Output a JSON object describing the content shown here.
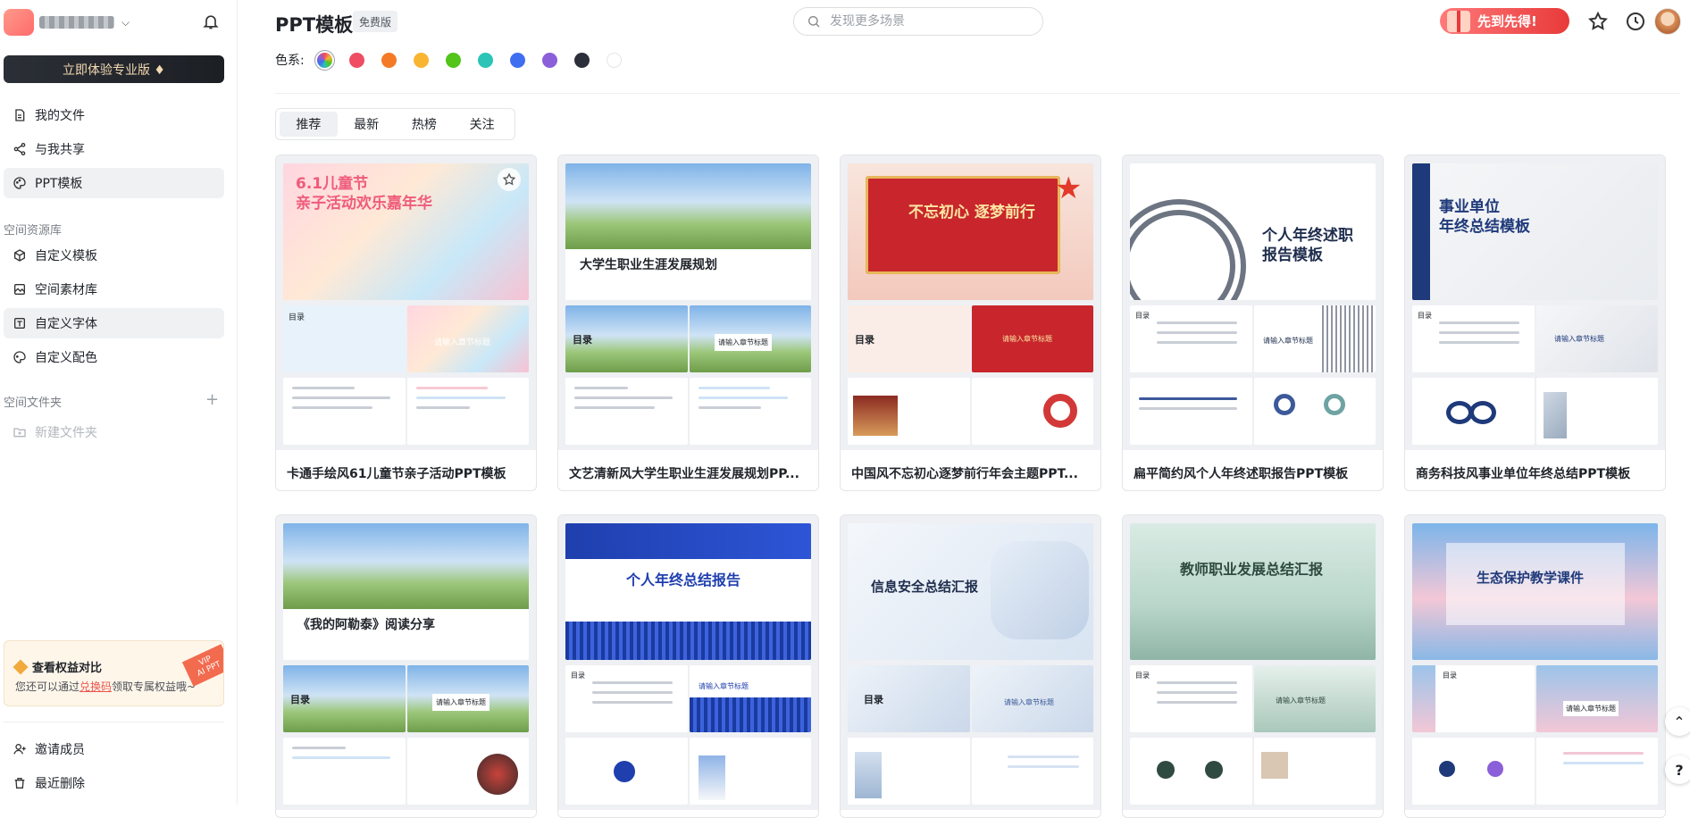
{
  "sidebar": {
    "pro_button": "立即体验专业版 ♦",
    "nav": [
      {
        "label": "我的文件"
      },
      {
        "label": "与我共享"
      },
      {
        "label": "PPT模板"
      }
    ],
    "space_library_label": "空间资源库",
    "space_items": [
      {
        "label": "自定义模板"
      },
      {
        "label": "空间素材库"
      },
      {
        "label": "自定义字体"
      },
      {
        "label": "自定义配色"
      }
    ],
    "folder_section_label": "空间文件夹",
    "new_folder": "新建文件夹",
    "vip": {
      "title": "查看权益对比",
      "sub_prefix": "您还可以通过",
      "sub_link": "兑换码",
      "sub_suffix": "领取专属权益哦~",
      "badge_top": "VIP",
      "badge_bottom": "AI PPT"
    },
    "bottom": [
      {
        "label": "邀请成员"
      },
      {
        "label": "最近删除"
      }
    ]
  },
  "header": {
    "title": "PPT模板",
    "badge": "免费版",
    "search_placeholder": "发现更多场景",
    "promo": "先到先得!"
  },
  "filters": {
    "color_label": "色系:",
    "swatches": [
      "rainbow",
      "#ee4d64",
      "#f47a26",
      "#f8b532",
      "#52c41a",
      "#2bc4b6",
      "#3f6ff0",
      "#8b5fd9",
      "#2b2f3a",
      "#ffffff"
    ]
  },
  "tabs": [
    {
      "label": "推荐"
    },
    {
      "label": "最新"
    },
    {
      "label": "热榜"
    },
    {
      "label": "关注"
    }
  ],
  "templates": [
    {
      "title": "卡通手绘风61儿童节亲子活动PPT模板",
      "hero": "6.1儿童节\n亲子活动欢乐嘉年华",
      "slide_a": "目录",
      "slide_b": "请输入章节标题"
    },
    {
      "title": "文艺清新风大学生职业生涯发展规划PP...",
      "hero": "大学生职业生涯发展规划",
      "slide_a": "目录",
      "slide_b": "请输入章节标题"
    },
    {
      "title": "中国风不忘初心逐梦前行年会主题PPT...",
      "hero": "不忘初心 逐梦前行",
      "slide_a": "目录",
      "slide_b": "请输入章节标题"
    },
    {
      "title": "扁平简约风个人年终述职报告PPT模板",
      "hero": "个人年终述职\n报告模板",
      "slide_a": "目录",
      "slide_b": "请输入章节标题"
    },
    {
      "title": "商务科技风事业单位年终总结PPT模板",
      "hero": "事业单位\n年终总结模板",
      "slide_a": "目录",
      "slide_b": "请输入章节标题"
    },
    {
      "title": "",
      "hero": "《我的阿勒泰》阅读分享",
      "slide_a": "目录",
      "slide_b": "请输入章节标题"
    },
    {
      "title": "",
      "hero": "个人年终总结报告",
      "slide_a": "目录",
      "slide_b": "请输入章节标题"
    },
    {
      "title": "",
      "hero": "信息安全总结汇报",
      "slide_a": "目录",
      "slide_b": "请输入章节标题"
    },
    {
      "title": "",
      "hero": "教师职业发展总结汇报",
      "slide_a": "目录",
      "slide_b": "请输入章节标题"
    },
    {
      "title": "",
      "hero": "生态保护教学课件",
      "slide_a": "目录",
      "slide_b": "请输入章节标题"
    }
  ],
  "fabs": {
    "up": "⌃",
    "help": "?"
  },
  "colors": {
    "accent": "#1f2329",
    "promo": "#e83a3a",
    "active_bg": "#f0f1f3"
  }
}
